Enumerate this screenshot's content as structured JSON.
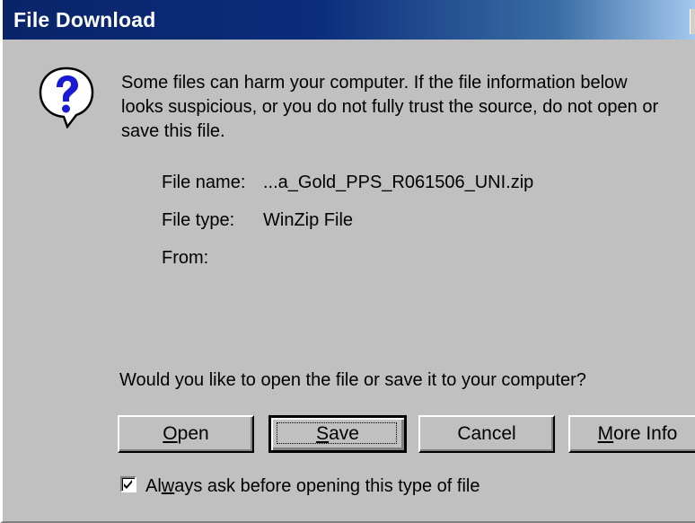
{
  "window": {
    "title": "File Download"
  },
  "icon": "question-mark-icon",
  "warning_lines": [
    "Some files can harm your computer. If the file information below",
    "looks suspicious, or you do not fully trust the source, do not open or",
    "save this file."
  ],
  "file_info": {
    "name_label": "File name:",
    "name_value": "...a_Gold_PPS_R061506_UNI.zip",
    "type_label": "File type:",
    "type_value": "WinZip File",
    "from_label": "From:",
    "from_value": ""
  },
  "question": "Would you like to open the file or save it to your computer?",
  "buttons": {
    "open_mnemonic": "O",
    "open_rest": "pen",
    "save_mnemonic": "S",
    "save_rest": "ave",
    "cancel": "Cancel",
    "more_info_mnemonic": "M",
    "more_info_rest": "ore Info"
  },
  "always_ask": {
    "checked": true,
    "pre": "Al",
    "mnemonic": "w",
    "post": "ays ask before opening this type of file"
  },
  "colors": {
    "title_start": "#0a246a",
    "title_end": "#a6caf0",
    "face": "#c0c0c0",
    "icon_blue": "#1a1ad4"
  }
}
